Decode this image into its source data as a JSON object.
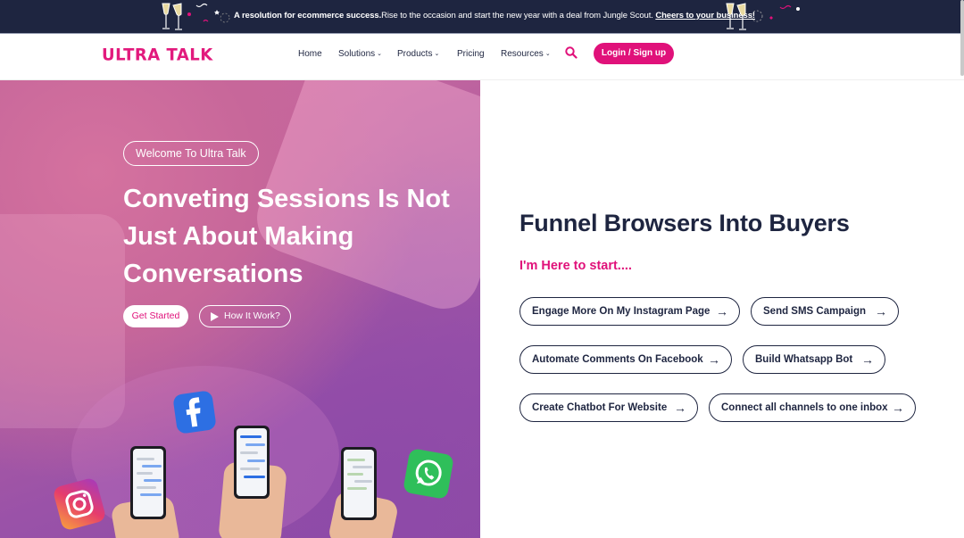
{
  "announcement": {
    "bold_lead": "A resolution for ecommerce success.",
    "text": "Rise to the occasion and start the new year with a deal from Jungle Scout.",
    "cta": "Cheers to your business!"
  },
  "header": {
    "logo": "ULTRA TALK",
    "nav": [
      {
        "label": "Home",
        "has_dropdown": false
      },
      {
        "label": "Solutions",
        "has_dropdown": true
      },
      {
        "label": "Products",
        "has_dropdown": true
      },
      {
        "label": "Pricing",
        "has_dropdown": false
      },
      {
        "label": "Resources",
        "has_dropdown": true
      }
    ],
    "search_icon": "search-icon",
    "login_label": "Login / Sign up"
  },
  "hero": {
    "badge": "Welcome To Ultra Talk",
    "title": "Conveting Sessions Is Not Just About Making Conversations",
    "get_started": "Get Started",
    "how_it_works": "How It Work?"
  },
  "right": {
    "title": "Funnel Browsers Into Buyers",
    "subtitle": "I'm Here to start....",
    "options": [
      "Engage More On My Instagram Page",
      "Send SMS Campaign",
      "Automate Comments On Facebook",
      "Build Whatsapp Bot",
      "Create Chatbot For Website",
      "Connect all channels to one inbox"
    ],
    "arrow_glyph": "→"
  },
  "colors": {
    "brand": "#e0117a",
    "navy": "#1e2540",
    "announce_bg": "#1e2540"
  }
}
